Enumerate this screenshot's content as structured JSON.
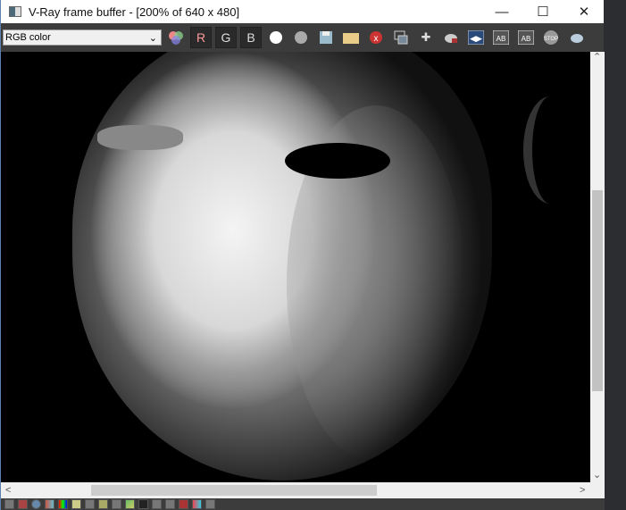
{
  "window": {
    "title": "V-Ray frame buffer - [200% of 640 x 480]"
  },
  "toolbar": {
    "channel_select": "RGB color",
    "r_label": "R",
    "g_label": "G",
    "b_label": "B",
    "icons": [
      "color-channels-icon",
      "white-circle-icon",
      "gray-circle-icon",
      "save-icon",
      "open-folder-icon",
      "clear-icon",
      "region-icon",
      "track-mouse-icon",
      "render-teapot-icon",
      "vfb-history-icon",
      "ab-compare-icon",
      "ab-compare-2-icon",
      "stop-icon",
      "render-icon"
    ]
  },
  "status_icons": [
    "display-icon",
    "region-icon",
    "info-icon",
    "color-correction-icon",
    "hsl-icon",
    "levels-icon",
    "curves-icon",
    "exposure-icon",
    "white-balance-icon",
    "lut-icon",
    "ocio-icon",
    "history-icon",
    "h-icon",
    "compare-icon",
    "channel-icon",
    "settings-icon"
  ],
  "accent": {
    "toolbar_bg": "#3c3c3c",
    "red_channel": "#ff8888"
  }
}
